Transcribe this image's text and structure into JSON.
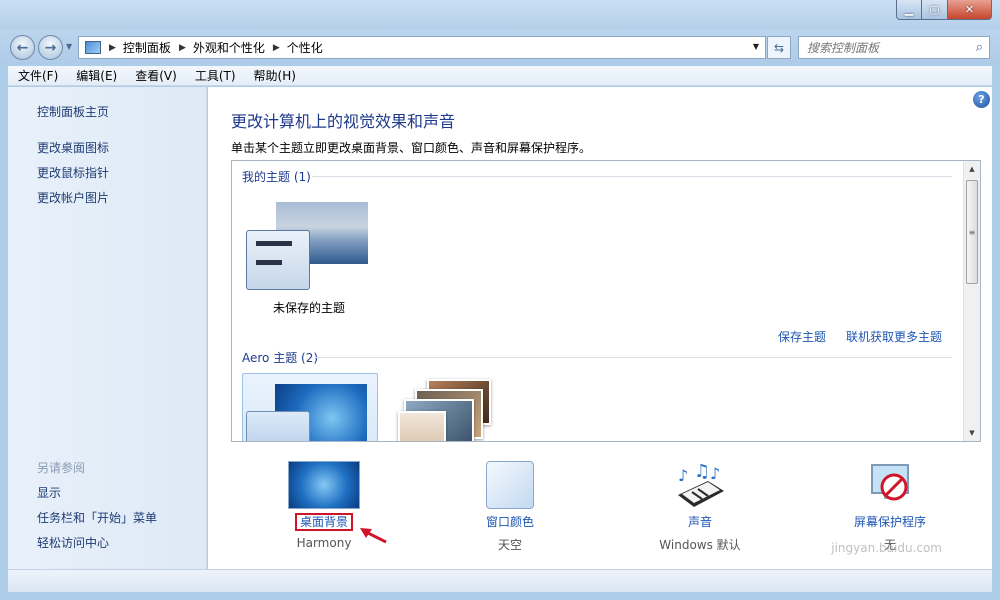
{
  "window": {
    "min_icon": "minimize-icon",
    "max_icon": "maximize-icon",
    "close_icon": "close-icon"
  },
  "address": {
    "breadcrumb": [
      "控制面板",
      "外观和个性化",
      "个性化"
    ],
    "search_placeholder": "搜索控制面板"
  },
  "menubar": [
    "文件(F)",
    "编辑(E)",
    "查看(V)",
    "工具(T)",
    "帮助(H)"
  ],
  "sidebar": {
    "links": [
      "控制面板主页",
      "更改桌面图标",
      "更改鼠标指针",
      "更改帐户图片"
    ],
    "see_also_title": "另请参阅",
    "see_also": [
      "显示",
      "任务栏和「开始」菜单",
      "轻松访问中心"
    ]
  },
  "main": {
    "heading": "更改计算机上的视觉效果和声音",
    "description": "单击某个主题立即更改桌面背景、窗口颜色、声音和屏幕保护程序。",
    "my_themes_title": "我的主题 (1)",
    "unsaved_theme_label": "未保存的主题",
    "save_theme": "保存主题",
    "get_more_themes": "联机获取更多主题",
    "aero_title": "Aero 主题 (2)"
  },
  "settings": [
    {
      "label": "桌面背景",
      "sub": "Harmony"
    },
    {
      "label": "窗口颜色",
      "sub": "天空"
    },
    {
      "label": "声音",
      "sub": "Windows 默认"
    },
    {
      "label": "屏幕保护程序",
      "sub": "无"
    }
  ],
  "watermark": "jingyan.baidu.com",
  "colors": {
    "heading": "#1e3a8c",
    "link": "#1e56b3",
    "highlight_box": "#d0152a"
  }
}
